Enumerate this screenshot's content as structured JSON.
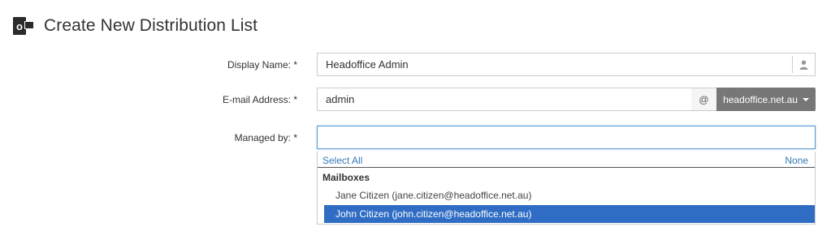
{
  "page": {
    "title": "Create New Distribution List"
  },
  "form": {
    "display_name": {
      "label": "Display Name: *",
      "value": "Headoffice Admin"
    },
    "email": {
      "label": "E-mail Address: *",
      "value": "admin",
      "at": "@",
      "domain": "headoffice.net.au"
    },
    "managed_by": {
      "label": "Managed by: *",
      "value": ""
    }
  },
  "dropdown": {
    "select_all": "Select All",
    "none": "None",
    "group": "Mailboxes",
    "options": [
      {
        "label": "Jane Citizen (jane.citizen@headoffice.net.au)",
        "selected": false
      },
      {
        "label": "John Citizen (john.citizen@headoffice.net.au)",
        "selected": true
      }
    ]
  },
  "colors": {
    "highlight": "#2f6cc4",
    "link": "#337ab7",
    "domain_button": "#777777"
  }
}
